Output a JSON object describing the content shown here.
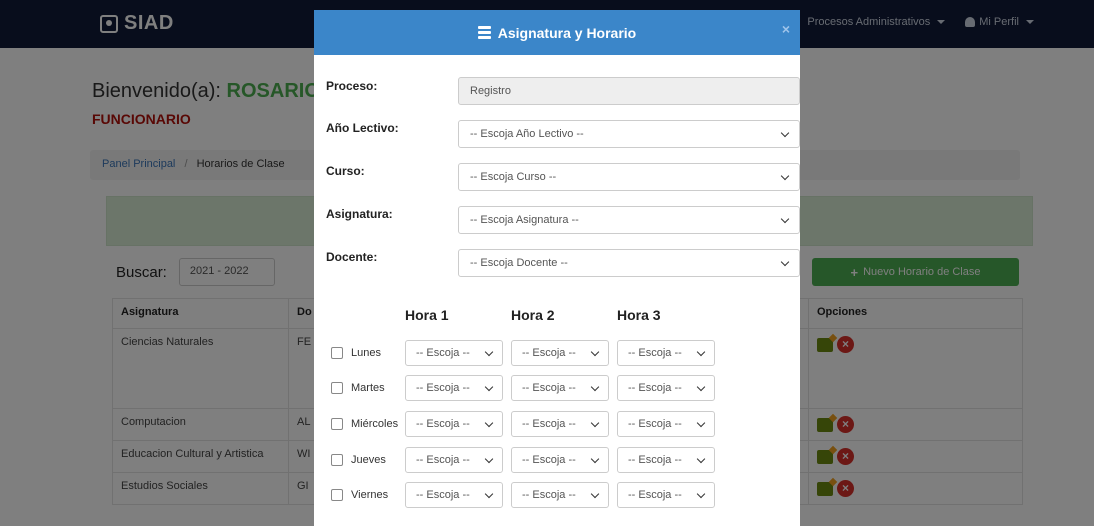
{
  "app": {
    "brand": "SIAD",
    "nav": {
      "procesos": "Procesos Administrativos",
      "perfil": "Mi Perfil"
    }
  },
  "background": {
    "welcome_prefix": "Bienvenido(a):",
    "welcome_name": "ROSARIO",
    "role": "FUNCIONARIO",
    "breadcrumb": [
      "Panel Principal",
      "Horarios de Clase"
    ],
    "search_label": "Buscar:",
    "search_value": "2021 - 2022",
    "new_button": "Nuevo Horario de Clase",
    "table": {
      "headers": [
        "Asignatura",
        "Do",
        "Opciones"
      ],
      "rows": [
        {
          "asignatura": "Ciencias Naturales",
          "docente": "FE"
        },
        {
          "asignatura": "Computacion",
          "docente": "AL"
        },
        {
          "asignatura": "Educacion Cultural y Artistica",
          "docente": "WI"
        },
        {
          "asignatura": "Estudios Sociales",
          "docente": "GI"
        }
      ]
    }
  },
  "modal": {
    "title": "Asignatura y Horario",
    "close": "×",
    "fields": {
      "proceso": {
        "label": "Proceso:",
        "value": "Registro"
      },
      "anio": {
        "label": "Año Lectivo:",
        "value": "-- Escoja Año Lectivo --"
      },
      "curso": {
        "label": "Curso:",
        "value": "-- Escoja Curso --"
      },
      "asignatura": {
        "label": "Asignatura:",
        "value": "-- Escoja Asignatura --"
      },
      "docente": {
        "label": "Docente:",
        "value": "-- Escoja Docente --"
      }
    },
    "schedule": {
      "hour_headers": [
        "Hora 1",
        "Hora 2",
        "Hora 3"
      ],
      "select_placeholder": "-- Escoja --",
      "days": [
        "Lunes",
        "Martes",
        "Miércoles",
        "Jueves",
        "Viernes"
      ]
    }
  }
}
